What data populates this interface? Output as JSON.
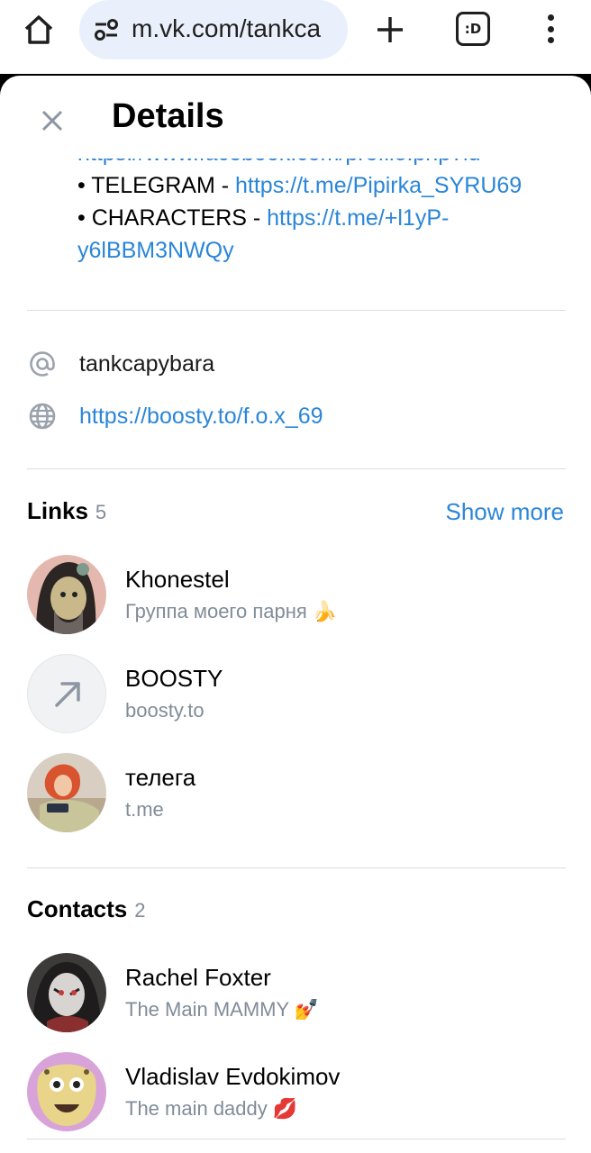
{
  "browser": {
    "url": "m.vk.com/tankca",
    "tabs_count": ":D"
  },
  "sheet": {
    "title": "Details"
  },
  "about": {
    "cut_line": "https://www.facebook.com/profile.php?id",
    "lines": [
      {
        "label": "• TELEGRAM - ",
        "link": "https://t.me/Pipirka_SYRU69"
      },
      {
        "label": "• CHARACTERS - ",
        "link": "https://t.me/+l1yP-"
      },
      {
        "label": "",
        "link": "y6lBBM3NWQy"
      }
    ]
  },
  "info": {
    "screen_name": "tankcapybara",
    "website": "https://boosty.to/f.o.x_69"
  },
  "links": {
    "heading": "Links",
    "count": "5",
    "show_more": "Show more",
    "items": [
      {
        "name": "Khonestel",
        "sub": "Группа моего парня 🍌"
      },
      {
        "name": "BOOSTY",
        "sub": "boosty.to"
      },
      {
        "name": "телега",
        "sub": "t.me"
      }
    ]
  },
  "contacts": {
    "heading": "Contacts",
    "count": "2",
    "items": [
      {
        "name": "Rachel Foxter",
        "sub": "The Main MAMMY 💅"
      },
      {
        "name": "Vladislav Evdokimov",
        "sub": "The main daddy 💋"
      }
    ]
  },
  "colors": {
    "link": "#2a86d8",
    "muted": "#818c99",
    "url_pill": "#eaf0fb"
  }
}
